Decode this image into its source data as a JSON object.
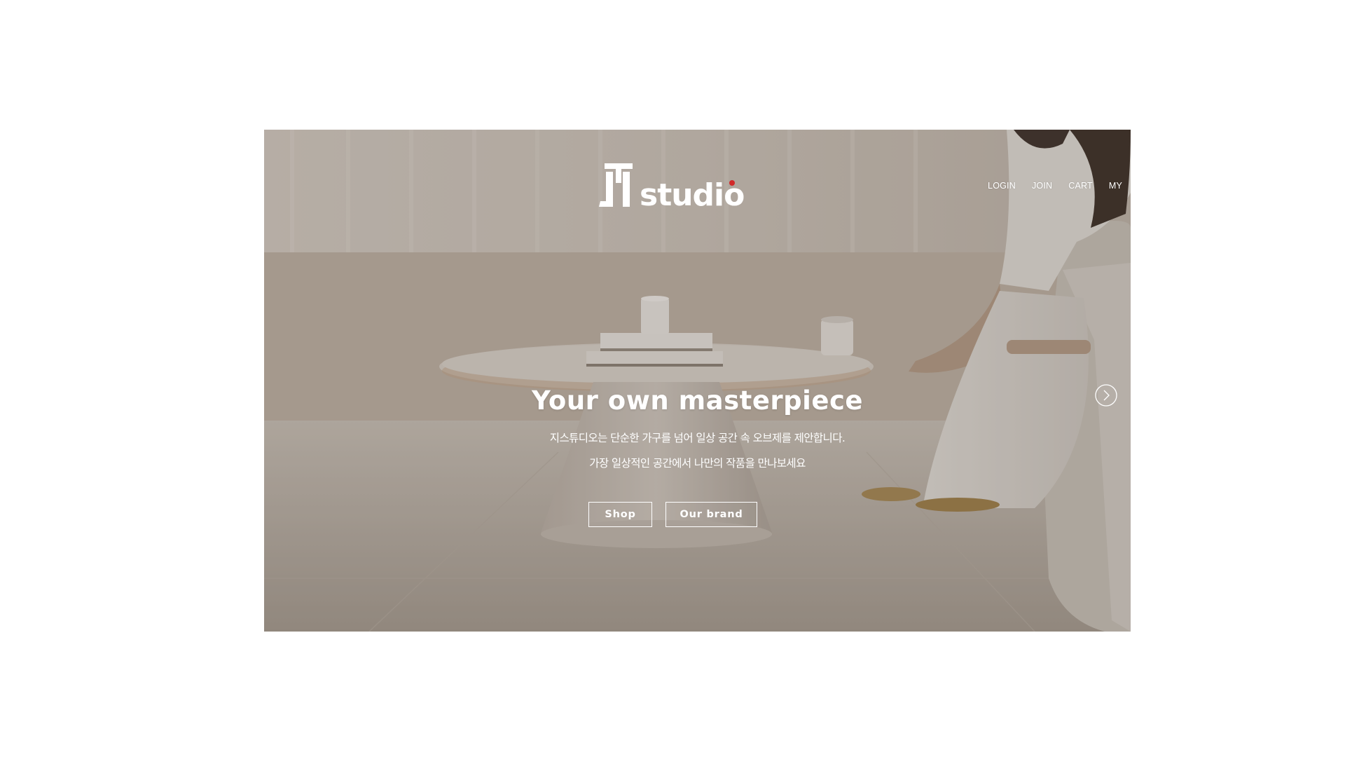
{
  "brand": {
    "logo_text": "JI studio"
  },
  "nav": {
    "items": [
      {
        "label": "LOGIN"
      },
      {
        "label": "JOIN"
      },
      {
        "label": "CART"
      },
      {
        "label": "MY"
      }
    ]
  },
  "hero": {
    "headline": "Your own masterpiece",
    "subtitle_line1": "지스튜디오는 단순한 가구를 넘어 일상 공간 속 오브제를 제안합니다.",
    "subtitle_line2": "가장 일상적인 공간에서 나만의 작품을 만나보세요",
    "buttons": {
      "shop": "Shop",
      "our_brand": "Our brand"
    },
    "next_slide_icon": "chevron-right-circle-icon"
  },
  "colors": {
    "page_background": "#ffffff",
    "hero_text": "#ffffff",
    "hero_tone": "#b3aba2"
  }
}
